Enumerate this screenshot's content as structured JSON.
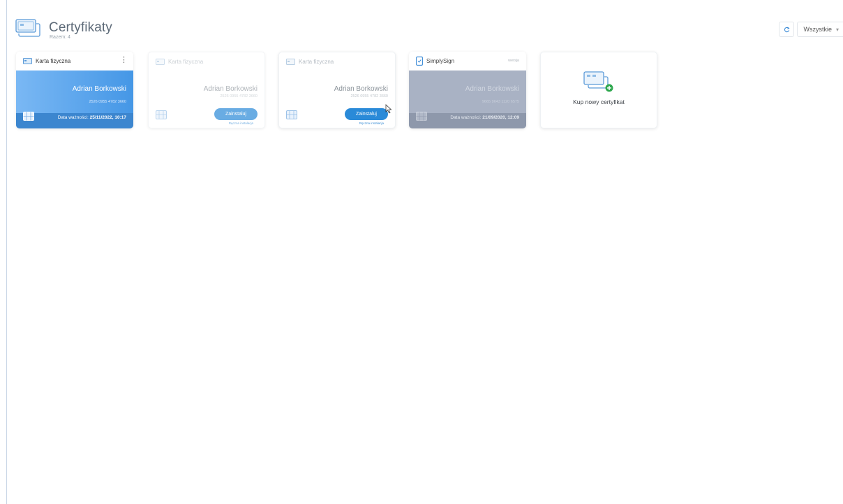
{
  "header": {
    "title": "Certyfikaty",
    "subtitle": "Razem: 4"
  },
  "toolbar": {
    "filter_value": "Wszystkie",
    "refresh_icon": "refresh-icon",
    "chevron_icon": "chevron-down-icon"
  },
  "cards": [
    {
      "type_label": "Karta fizyczna",
      "owner": "Adrian Borkowski",
      "serial": "2526 0955 4782 3660",
      "expiry_label": "Data ważności:",
      "expiry_value": "25/11/2022, 10:17",
      "state": "active",
      "color": "#4597e6"
    },
    {
      "type_label": "Karta fizyczna",
      "owner": "Adrian Borkowski",
      "serial": "2526 0955 4782 3660",
      "install_label": "Zainstaluj",
      "install_note": "Ręczna instalacja",
      "state": "not-installed"
    },
    {
      "type_label": "Karta fizyczna",
      "owner": "Adrian Borkowski",
      "serial": "2526 0955 4782 3660",
      "install_label": "Zainstaluj",
      "install_note": "Ręczna instalacja",
      "state": "not-installed"
    },
    {
      "type_label": "SimplySign",
      "status_tag": "wersja",
      "owner": "Adrian Borkowski",
      "serial": "9665 9643 1120 6575",
      "expiry_label": "Data ważności:",
      "expiry_value": "21/09/2020, 12:09",
      "state": "expired",
      "color": "#a9b2c4"
    },
    {
      "label": "Kup nowy certyfikat",
      "icon": "add-card-icon",
      "accent": "#2fa84f"
    }
  ]
}
